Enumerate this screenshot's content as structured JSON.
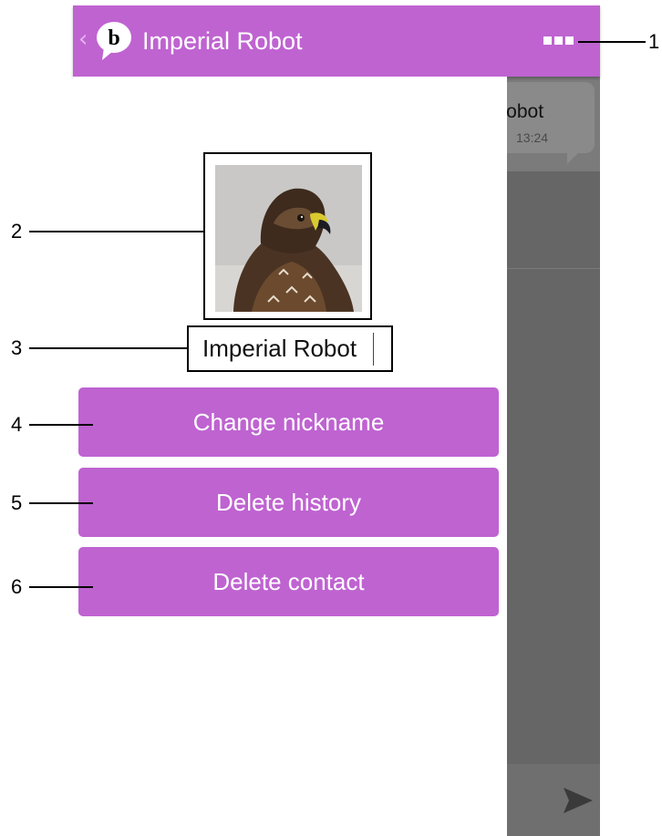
{
  "app_bar": {
    "title": "Imperial Robot",
    "logo_letter": "b",
    "back_icon": "chevron-left-icon",
    "menu_icon": "overflow-menu-icon",
    "color": "#bf63d1"
  },
  "chat": {
    "message_text": "al robot",
    "message_time": "13:24",
    "send_icon": "send-icon"
  },
  "profile": {
    "avatar_alt": "hawk avatar",
    "nickname_value": "Imperial Robot"
  },
  "actions": [
    {
      "label": "Change nickname"
    },
    {
      "label": "Delete history"
    },
    {
      "label": "Delete contact"
    }
  ],
  "callouts": [
    "1",
    "2",
    "3",
    "4",
    "5",
    "6"
  ]
}
